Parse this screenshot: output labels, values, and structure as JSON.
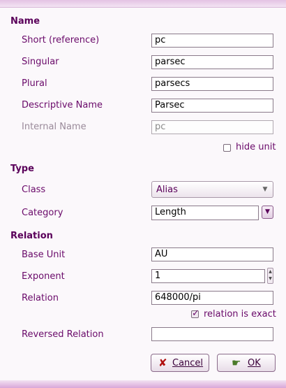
{
  "sections": {
    "name": "Name",
    "type": "Type",
    "relation": "Relation"
  },
  "name": {
    "short_label": "Short (reference)",
    "short_value": "pc",
    "singular_label": "Singular",
    "singular_value": "parsec",
    "plural_label": "Plural",
    "plural_value": "parsecs",
    "descriptive_label": "Descriptive Name",
    "descriptive_value": "Parsec",
    "internal_label": "Internal Name",
    "internal_value": "pc",
    "hide_unit_label": "hide unit",
    "hide_unit_checked": false
  },
  "type": {
    "class_label": "Class",
    "class_value": "Alias",
    "category_label": "Category",
    "category_value": "Length"
  },
  "relation": {
    "base_unit_label": "Base Unit",
    "base_unit_value": "AU",
    "exponent_label": "Exponent",
    "exponent_value": "1",
    "relation_label": "Relation",
    "relation_value": "648000/pi",
    "exact_label": "relation is exact",
    "exact_checked": true,
    "reversed_label": "Reversed Relation",
    "reversed_value": ""
  },
  "buttons": {
    "cancel_label": "Cancel",
    "ok_label": "OK"
  },
  "icons": {
    "cancel": "cancel-x-icon",
    "ok": "ok-hand-icon",
    "combo_arrow": "chevron-down-icon",
    "spin_up": "spin-up-icon",
    "spin_down": "spin-down-icon"
  },
  "colors": {
    "accent": "#6a0a6a",
    "background": "#fbf8fb"
  }
}
